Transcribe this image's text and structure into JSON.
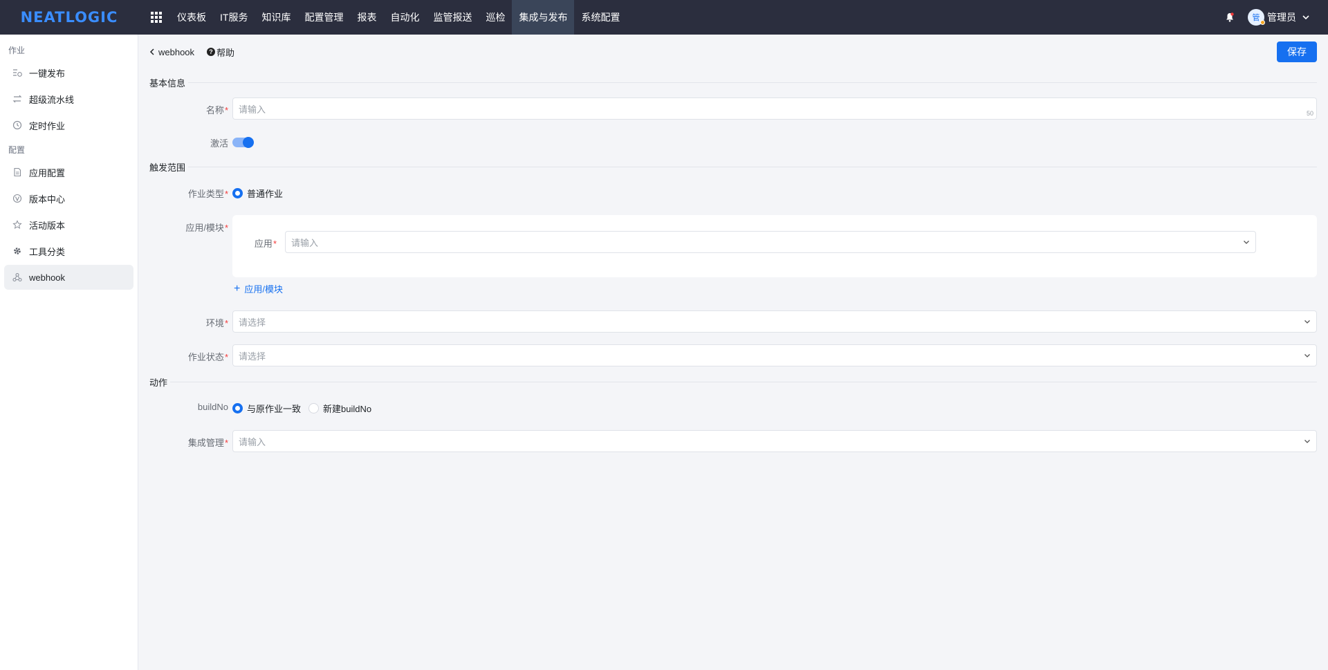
{
  "topbar": {
    "logo": "NEATLOGIC",
    "nav": [
      "仪表板",
      "IT服务",
      "知识库",
      "配置管理",
      "报表",
      "自动化",
      "监管报送",
      "巡检",
      "集成与发布",
      "系统配置"
    ],
    "active_nav": "集成与发布",
    "avatar_char": "管",
    "username": "管理员"
  },
  "sidebar": {
    "group1": "作业",
    "items1": [
      "一键发布",
      "超级流水线",
      "定时作业"
    ],
    "group2": "配置",
    "items2": [
      "应用配置",
      "版本中心",
      "活动版本",
      "工具分类",
      "webhook"
    ],
    "active": "webhook"
  },
  "header": {
    "back_label": "webhook",
    "help_label": "帮助",
    "save_label": "保存"
  },
  "form": {
    "section_basic": "基本信息",
    "name_label": "名称",
    "name_placeholder": "请输入",
    "name_counter": "50",
    "active_label": "激活",
    "section_trigger": "触发范围",
    "job_type_label": "作业类型",
    "job_type_option": "普通作业",
    "app_module_label": "应用/模块",
    "app_label": "应用",
    "app_placeholder": "请输入",
    "add_app_module": "应用/模块",
    "env_label": "环境",
    "env_placeholder": "请选择",
    "job_status_label": "作业状态",
    "job_status_placeholder": "请选择",
    "section_action": "动作",
    "buildno_label": "buildNo",
    "buildno_option1": "与原作业一致",
    "buildno_option2": "新建buildNo",
    "integration_label": "集成管理",
    "integration_placeholder": "请输入",
    "required_mark": "*"
  },
  "colors": {
    "primary": "#1670f0",
    "topbar": "#2b2e3e",
    "required": "#f33b3b"
  }
}
